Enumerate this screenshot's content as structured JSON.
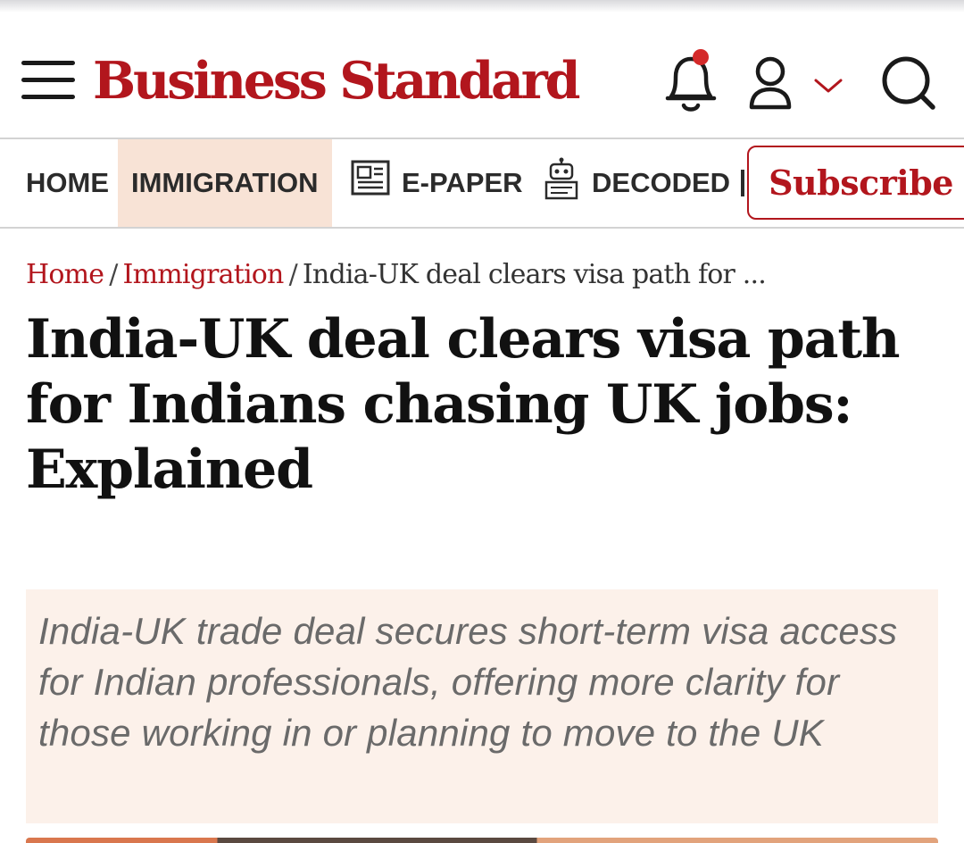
{
  "header": {
    "logo": "Business Standard",
    "icons": [
      "menu-icon",
      "bell-icon",
      "user-icon",
      "chevron-down-icon",
      "search-icon"
    ],
    "notification_dot": true
  },
  "nav": {
    "items": [
      {
        "label": "HOME",
        "active": false
      },
      {
        "label": "IMMIGRATION",
        "active": true
      },
      {
        "label": "E-PAPER",
        "icon": "newspaper-icon"
      },
      {
        "label": "DECODED",
        "icon": "robot-icon"
      }
    ],
    "subscribe_label": "Subscribe"
  },
  "breadcrumb": {
    "home": "Home",
    "section": "Immigration",
    "current": "India-UK deal clears visa path for ...",
    "separator": "/"
  },
  "article": {
    "headline": "India-UK deal clears visa path for Indians chasing UK jobs: Explained",
    "summary": "India-UK trade deal secures short-term visa access for Indian professionals, offering more clarity for those working in or planning to move to the UK"
  },
  "colors": {
    "brand": "#b2161d",
    "active_tab_bg": "#f8e3d6",
    "summary_bg": "#fcf1ea"
  }
}
